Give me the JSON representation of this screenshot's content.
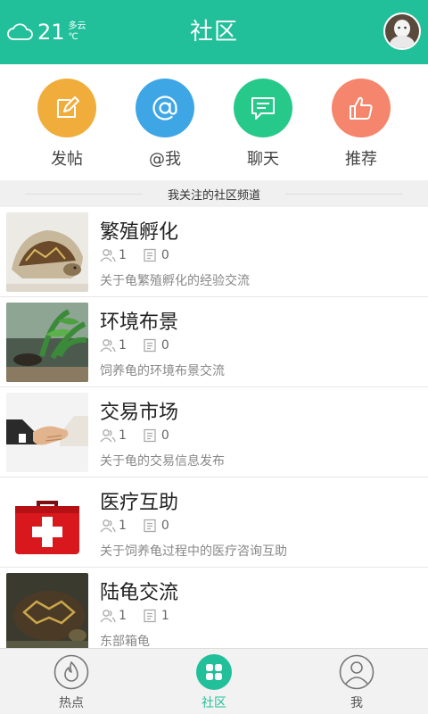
{
  "status": {
    "temperature": "21",
    "weather": "多云",
    "unit": "℃"
  },
  "header": {
    "title": "社区"
  },
  "shortcuts": [
    {
      "label": "发帖",
      "color": "#f0ad3c",
      "icon": "edit-icon"
    },
    {
      "label": "@我",
      "color": "#3fa6e6",
      "icon": "at-icon"
    },
    {
      "label": "聊天",
      "color": "#26c98a",
      "icon": "chat-icon"
    },
    {
      "label": "推荐",
      "color": "#f5856c",
      "icon": "thumbs-up-icon"
    }
  ],
  "section": {
    "title": "我关注的社区频道"
  },
  "channels": [
    {
      "name": "繁殖孵化",
      "members": "1",
      "posts": "0",
      "desc": "关于龟繁殖孵化的经验交流",
      "thumb": "turtle-hatching-photo"
    },
    {
      "name": "环境布景",
      "members": "1",
      "posts": "0",
      "desc": "饲养龟的环境布景交流",
      "thumb": "aquarium-photo"
    },
    {
      "name": "交易市场",
      "members": "1",
      "posts": "0",
      "desc": "关于龟的交易信息发布",
      "thumb": "handshake-photo"
    },
    {
      "name": "医疗互助",
      "members": "1",
      "posts": "0",
      "desc": "关于饲养龟过程中的医疗咨询互助",
      "thumb": "first-aid-kit-photo"
    },
    {
      "name": "陆龟交流",
      "members": "1",
      "posts": "1",
      "desc": "东部箱龟",
      "thumb": "tortoise-photo"
    }
  ],
  "nav": [
    {
      "label": "热点",
      "icon": "flame-icon",
      "active": false
    },
    {
      "label": "社区",
      "icon": "grid-icon",
      "active": true
    },
    {
      "label": "我",
      "icon": "person-icon",
      "active": false
    }
  ],
  "colors": {
    "brand": "#22c09a"
  }
}
